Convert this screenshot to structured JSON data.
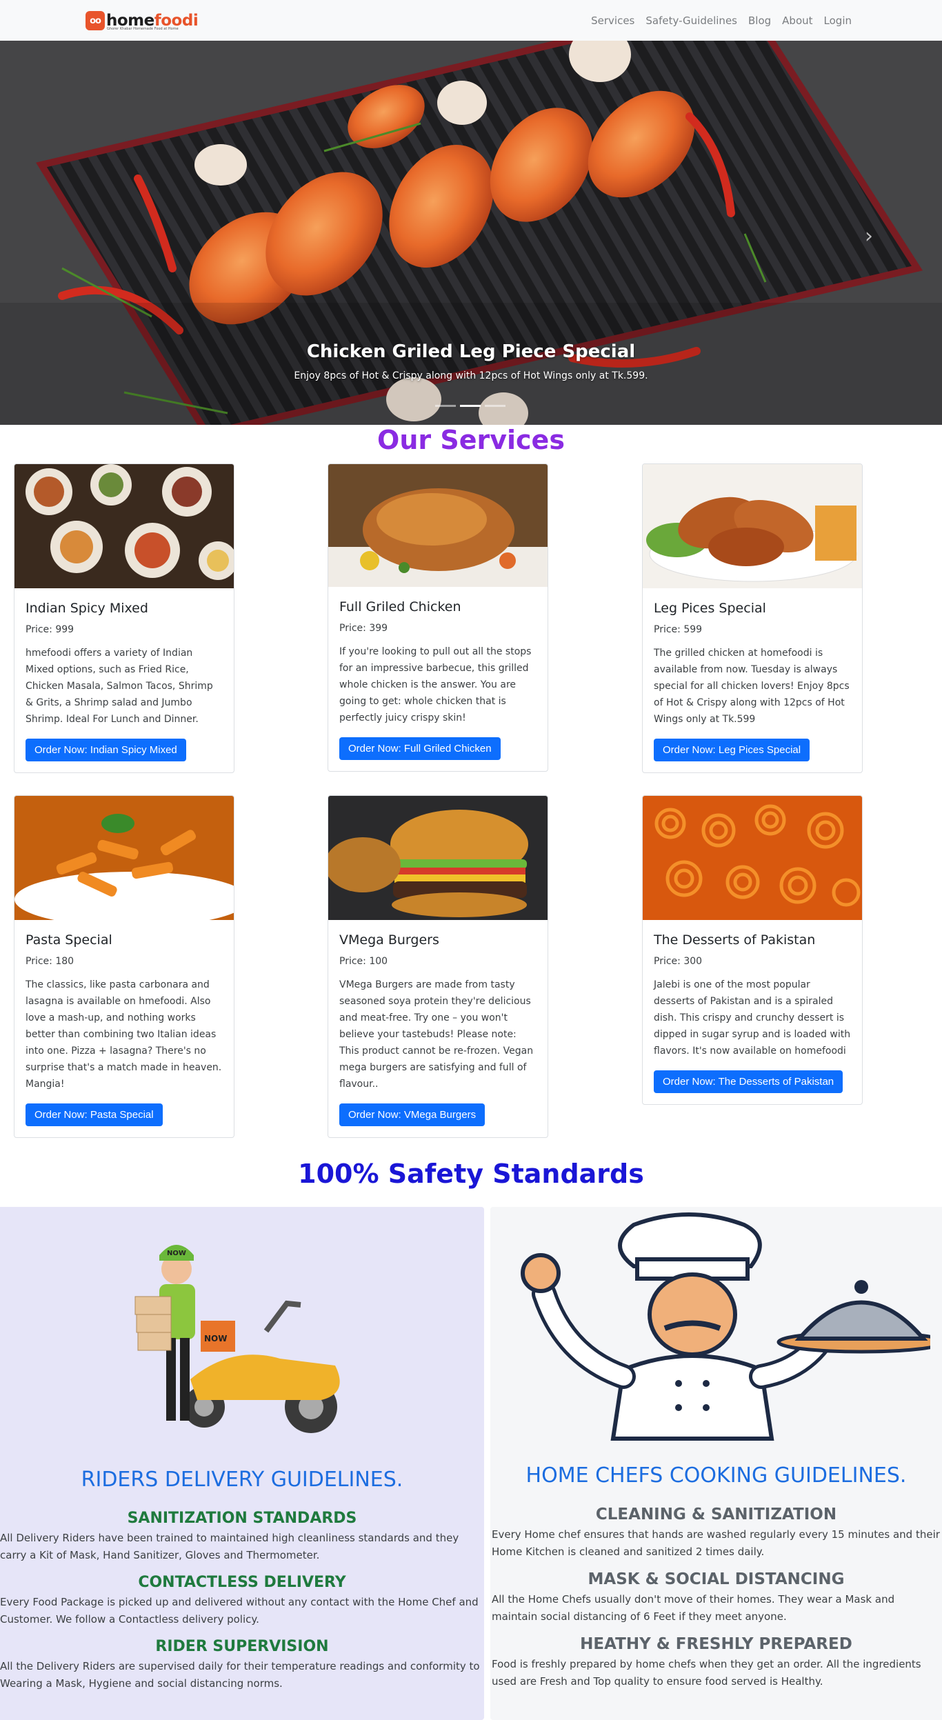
{
  "nav": {
    "brand": {
      "mark": "oo",
      "name_prefix": "home",
      "name_suffix": "foodi",
      "tagline": "Ghorer Khabar Homemade Food at Home"
    },
    "links": [
      "Services",
      "Safety-Guidelines",
      "Blog",
      "About",
      "Login"
    ]
  },
  "hero": {
    "title": "Chicken Griled Leg Piece Special",
    "subtitle": "Enjoy 8pcs of Hot & Crispy along with 12pcs of Hot Wings only at Tk.599.",
    "next_icon": "chevron-right-icon",
    "slide_count": 3,
    "active_slide": 2
  },
  "services": {
    "title": "Our Services",
    "cards": [
      {
        "name": "Indian Spicy Mixed",
        "price": "Price: 999",
        "description": "hmefoodi offers a variety of Indian Mixed options, such as Fried Rice, Chicken Masala, Salmon Tacos, Shrimp & Grits, a Shrimp salad and Jumbo Shrimp. Ideal For Lunch and Dinner.",
        "button": "Order Now: Indian Spicy Mixed"
      },
      {
        "name": "Full Griled Chicken",
        "price": "Price: 399",
        "description": "If you're looking to pull out all the stops for an impressive barbecue, this grilled whole chicken is the answer. You are going to get: whole chicken that is perfectly juicy crispy skin!",
        "button": "Order Now: Full Griled Chicken"
      },
      {
        "name": "Leg Pices Special",
        "price": "Price: 599",
        "description": "The grilled chicken at homefoodi is available from now. Tuesday is always special for all chicken lovers! Enjoy 8pcs of Hot & Crispy along with 12pcs of Hot Wings only at Tk.599",
        "button": "Order Now: Leg Pices Special"
      },
      {
        "name": "Pasta Special",
        "price": "Price: 180",
        "description": "The classics, like pasta carbonara and lasagna is available on hmefoodi. Also love a mash-up, and nothing works better than combining two Italian ideas into one. Pizza + lasagna? There's no surprise that's a match made in heaven. Mangia!",
        "button": "Order Now: Pasta Special"
      },
      {
        "name": "VMega Burgers",
        "price": "Price: 100",
        "description": "VMega Burgers are made from tasty seasoned soya protein they're delicious and meat-free. Try one – you won't believe your tastebuds! Please note: This product cannot be re-frozen. Vegan mega burgers are satisfying and full of flavour..",
        "button": "Order Now: VMega Burgers"
      },
      {
        "name": "The Desserts of Pakistan",
        "price": "Price: 300",
        "description": "Jalebi is one of the most popular desserts of Pakistan and is a spiraled dish. This crispy and crunchy dessert is dipped in sugar syrup and is loaded with flavors. It's now available on homefoodi",
        "button": "Order Now: The Desserts of Pakistan"
      }
    ]
  },
  "safety": {
    "title": "100% Safety Standards",
    "riders": {
      "heading": "RIDERS DELIVERY GUIDELINES.",
      "box_label": "NOW",
      "sections": [
        {
          "title": "SANITIZATION STANDARDS",
          "text": "All Delivery Riders have been trained to maintained high cleanliness standards and they carry a Kit of Mask, Hand Sanitizer, Gloves and Thermometer."
        },
        {
          "title": "CONTACTLESS DELIVERY",
          "text": "Every Food Package is picked up and delivered without any contact with the Home Chef and Customer. We follow a Contactless delivery policy."
        },
        {
          "title": "RIDER SUPERVISION",
          "text": "All the Delivery Riders are supervised daily for their temperature readings and conformity to Wearing a Mask, Hygiene and social distancing norms."
        }
      ]
    },
    "chefs": {
      "heading": "HOME CHEFS COOKING GUIDELINES.",
      "sections": [
        {
          "title": "CLEANING & SANITIZATION",
          "text": "Every Home chef ensures that hands are washed regularly every 15 minutes and their Home Kitchen is cleaned and sanitized 2 times daily."
        },
        {
          "title": "MASK & SOCIAL DISTANCING",
          "text": "All the Home Chefs usually don't move of their homes. They wear a Mask and maintain social distancing of 6 Feet if they meet anyone."
        },
        {
          "title": "HEATHY & FRESHLY PREPARED",
          "text": "Food is freshly prepared by home chefs when they get an order. All the ingredients used are Fresh and Top quality to ensure food served is Healthy."
        }
      ]
    }
  }
}
